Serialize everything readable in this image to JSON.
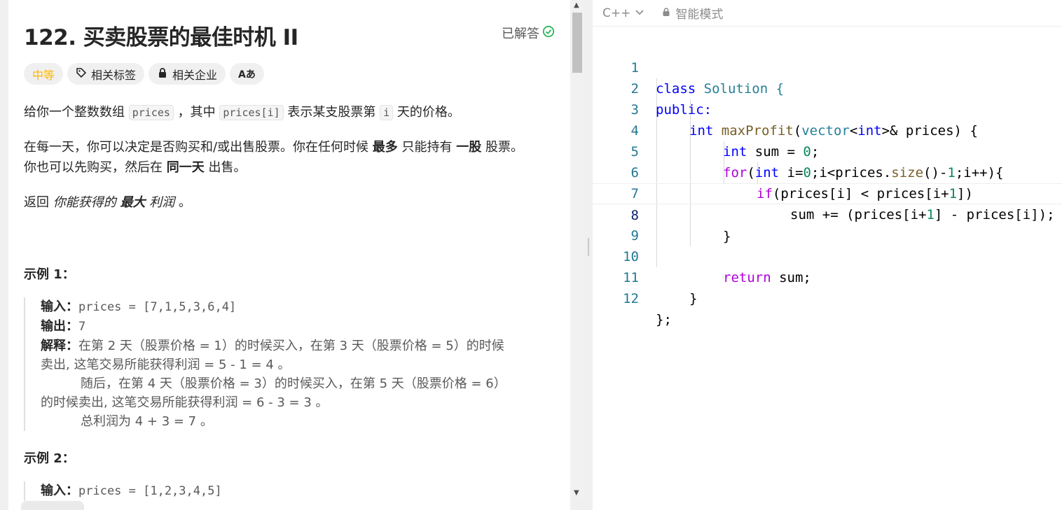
{
  "problem": {
    "title": "122. 买卖股票的最佳时机 II",
    "status": "已解答",
    "tags": {
      "difficulty": "中等",
      "related_tags": "相关标签",
      "related_companies": "相关企业",
      "translate": "Aあ"
    },
    "desc1": {
      "pre": "给你一个整数数组 ",
      "code1": "prices",
      "mid1": " ，其中 ",
      "code2": "prices[i]",
      "mid2": " 表示某支股票第 ",
      "code3": "i",
      "post": " 天的价格。"
    },
    "desc2": {
      "pre": "在每一天，你可以决定是否购买和/或出售股票。你在任何时候 ",
      "bold1": "最多",
      "mid": " 只能持有 ",
      "bold2": "一股",
      "post": " 股票。",
      "line2_pre": "你也可以先购买，然后在 ",
      "bold3": "同一天",
      "line2_post": " 出售。"
    },
    "desc3": {
      "pre": "返回 ",
      "it1": "你能获得的 ",
      "bold": "最大",
      "it2": " 利润",
      "post": " 。"
    },
    "example1": {
      "title": "示例 1：",
      "input_label": "输入：",
      "input": "prices = [7,1,5,3,6,4]",
      "output_label": "输出：",
      "output": "7",
      "explain_label": "解释：",
      "explain1": "在第 2 天（股票价格 = 1）的时候买入，在第 3 天（股票价格 = 5）的时候",
      "explain2": "卖出, 这笔交易所能获得利润 = 5 - 1 = 4 。",
      "explain3": "随后，在第 4 天（股票价格 = 3）的时候买入，在第 5 天（股票价格 = 6）",
      "explain4": "的时候卖出, 这笔交易所能获得利润 = 6 - 3 = 3 。",
      "explain5": "总利润为 4 + 3 = 7 。"
    },
    "example2": {
      "title": "示例 2：",
      "input_label": "输入：",
      "input": "prices = [1,2,3,4,5]"
    }
  },
  "editor": {
    "language": "C++",
    "mode": "智能模式",
    "lines": [
      {
        "n": "1"
      },
      {
        "n": "2"
      },
      {
        "n": "3"
      },
      {
        "n": "4"
      },
      {
        "n": "5"
      },
      {
        "n": "6"
      },
      {
        "n": "7"
      },
      {
        "n": "8"
      },
      {
        "n": "9"
      },
      {
        "n": "10"
      },
      {
        "n": "11"
      },
      {
        "n": "12"
      }
    ],
    "code": {
      "l1a": "class",
      "l1b": " Solution {",
      "l2": "public:",
      "l3a": "int",
      "l3b": "maxProfit",
      "l3c": "(",
      "l3d": "vector",
      "l3e": "<",
      "l3f": "int",
      "l3g": ">& prices) {",
      "l4a": "int",
      "l4b": " sum = ",
      "l4c": "0",
      "l4d": ";",
      "l5a": "for",
      "l5b": "(",
      "l5c": "int",
      "l5d": " i=",
      "l5e": "0",
      "l5f": ";i<prices.",
      "l5g": "size",
      "l5h": "()-",
      "l5i": "1",
      "l5j": ";i++){",
      "l6a": "if",
      "l6b": "(prices[i] < prices[i+",
      "l6c": "1",
      "l6d": "])",
      "l7a": "sum += (prices[i+",
      "l7b": "1",
      "l7c": "] - prices[i]);",
      "l8": "}",
      "l10a": "return",
      "l10b": " sum;",
      "l11": "}",
      "l12": "};"
    }
  },
  "colors": {
    "keyword": "#0000ff",
    "control": "#af00db",
    "type": "#267f99",
    "number": "#098658",
    "difficulty": "#ffb800",
    "solved_check": "#2db55d"
  }
}
